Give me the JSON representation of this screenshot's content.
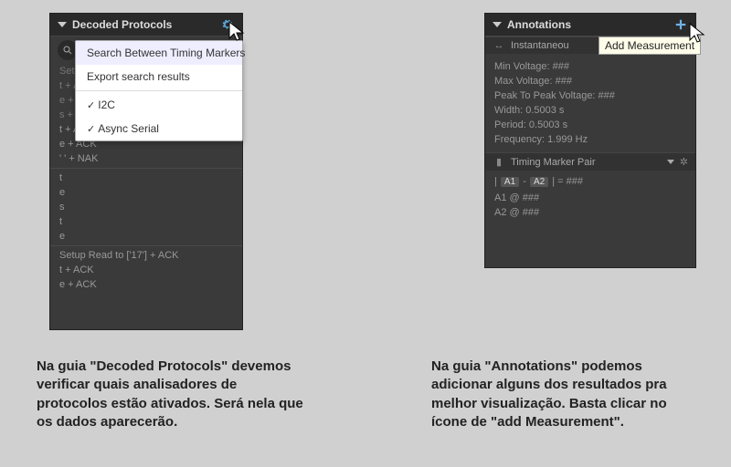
{
  "left_panel": {
    "title": "Decoded Protocols",
    "search_placeholder": "Search",
    "dropdown": {
      "item1": "Search Between Timing Markers",
      "item2": "Export search results",
      "proto1": "I2C",
      "proto2": "Async Serial"
    },
    "rows": [
      "Setup",
      "t + A...",
      "e + A...",
      "s + A...",
      "t + ACK",
      "e + ACK",
      "' ' + NAK",
      "t",
      "e",
      "s",
      "t",
      "e",
      "Setup Read to ['17'] + ACK",
      "t + ACK",
      "e + ACK"
    ]
  },
  "right_panel": {
    "title": "Annotations",
    "tooltip": "Add Measurement",
    "section1": "Instantaneou",
    "measurements": {
      "minv": "Min Voltage: ###",
      "maxv": "Max Voltage: ###",
      "pp": "Peak To Peak Voltage: ###",
      "width": "Width: 0.5003 s",
      "period": "Period: 0.5003 s",
      "freq": "Frequency: 1.999 Hz"
    },
    "timing_header": "Timing Marker Pair",
    "a1": "A1",
    "a2": "A2",
    "pair_eq": " = ###",
    "a1_line": "A1  @  ###",
    "a2_line": "A2  @  ###"
  },
  "captions": {
    "left": "Na guia \"Decoded Protocols\" devemos verificar quais analisadores de protocolos estão ativados. Será nela que os dados aparecerão.",
    "right": "Na guia \"Annotations\" podemos adicionar alguns dos resultados pra melhor visualização. Basta clicar no ícone de \"add Measurement\"."
  }
}
